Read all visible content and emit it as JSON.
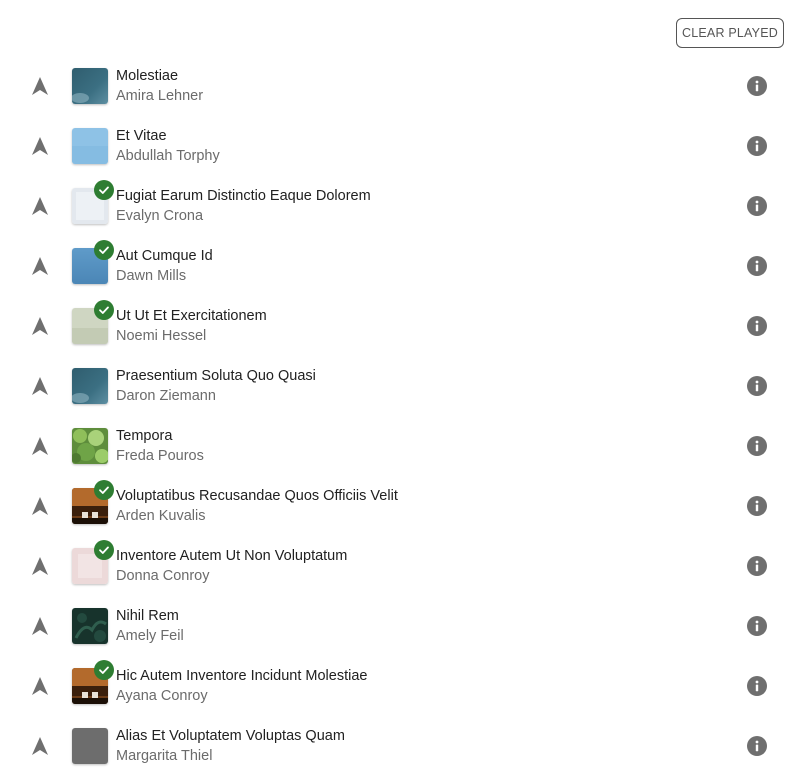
{
  "toolbar": {
    "clear_played_label": "CLEAR PLAYED"
  },
  "colors": {
    "played_badge": "#2e7d32",
    "icon_gray": "#6f6f6f"
  },
  "tracks": [
    {
      "title": "Molestiae",
      "artist": "Amira Lehner",
      "played": false,
      "art": "teal-dark"
    },
    {
      "title": "Et Vitae",
      "artist": "Abdullah Torphy",
      "played": false,
      "art": "sky-blue"
    },
    {
      "title": "Fugiat Earum Distinctio Eaque Dolorem",
      "artist": "Evalyn Crona",
      "played": true,
      "art": "pale-gray"
    },
    {
      "title": "Aut Cumque Id",
      "artist": "Dawn Mills",
      "played": true,
      "art": "steel-blue"
    },
    {
      "title": "Ut Ut Et Exercitationem",
      "artist": "Noemi Hessel",
      "played": true,
      "art": "sage"
    },
    {
      "title": "Praesentium Soluta Quo Quasi",
      "artist": "Daron Ziemann",
      "played": false,
      "art": "teal-dark"
    },
    {
      "title": "Tempora",
      "artist": "Freda Pouros",
      "played": false,
      "art": "leaves"
    },
    {
      "title": "Voluptatibus Recusandae Quos Officiis Velit",
      "artist": "Arden Kuvalis",
      "played": true,
      "art": "amber-stage"
    },
    {
      "title": "Inventore Autem Ut Non Voluptatum",
      "artist": "Donna Conroy",
      "played": true,
      "art": "blush"
    },
    {
      "title": "Nihil Rem",
      "artist": "Amely Feil",
      "played": false,
      "art": "dark-foliage"
    },
    {
      "title": "Hic Autem Inventore Incidunt Molestiae",
      "artist": "Ayana Conroy",
      "played": true,
      "art": "amber-stage"
    },
    {
      "title": "Alias Et Voluptatem Voluptas Quam",
      "artist": "Margarita Thiel",
      "played": false,
      "art": "gray"
    }
  ]
}
